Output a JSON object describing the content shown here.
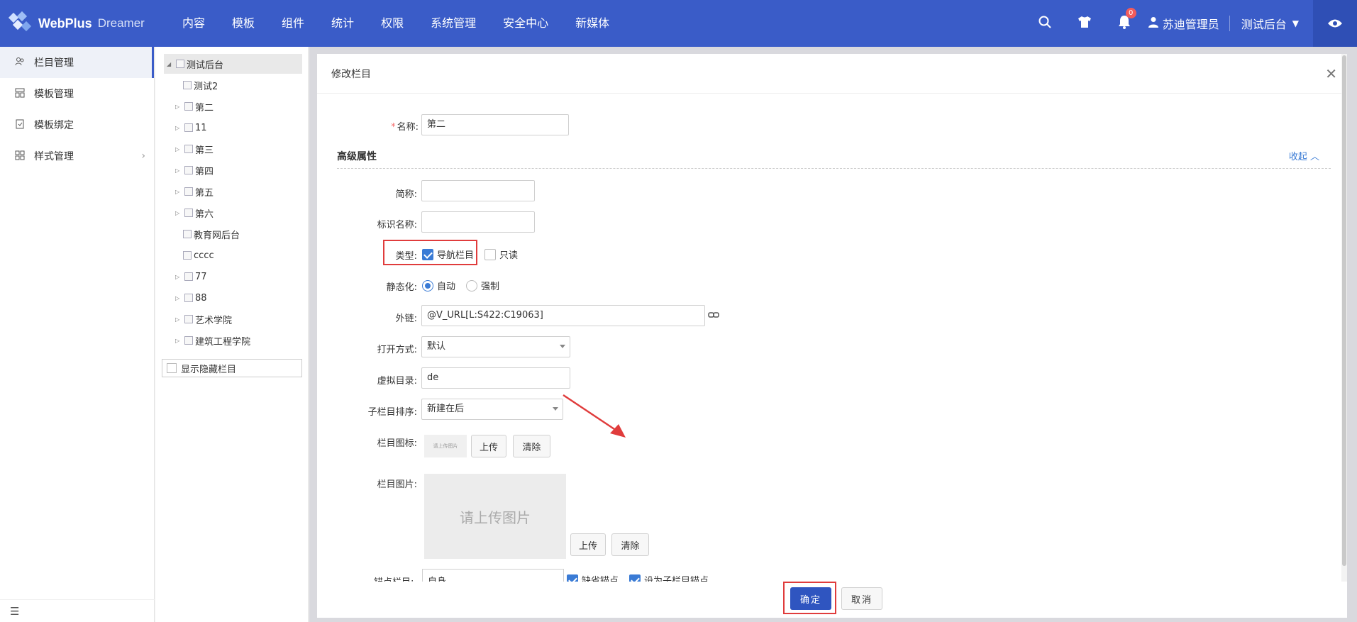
{
  "header": {
    "logo_text": "WebPlus",
    "logo_sub": "Dreamer",
    "nav": [
      "内容",
      "模板",
      "组件",
      "统计",
      "权限",
      "系统管理",
      "安全中心",
      "新媒体"
    ],
    "notification_count": "0",
    "user_name": "苏迪管理员",
    "site_name": "测试后台",
    "brand_color": "#3a5cc8"
  },
  "sidebar": {
    "items": [
      {
        "label": "栏目管理",
        "icon": "users-icon"
      },
      {
        "label": "模板管理",
        "icon": "template-icon"
      },
      {
        "label": "模板绑定",
        "icon": "bind-icon"
      },
      {
        "label": "样式管理",
        "icon": "style-icon"
      }
    ]
  },
  "tree": {
    "root": "测试后台",
    "items": [
      "测试2",
      "第二",
      "11",
      "第三",
      "第四",
      "第五",
      "第六",
      "教育网后台",
      "cccc",
      "77",
      "88",
      "艺术学院",
      "建筑工程学院"
    ],
    "show_hidden_label": "显示隐藏栏目"
  },
  "dialog": {
    "title": "修改栏目",
    "name_label": "名称:",
    "name_value": "第二",
    "section_title": "高级属性",
    "collapse_label": "收起",
    "short_name_label": "简称:",
    "short_name_value": "",
    "ident_label": "标识名称:",
    "ident_value": "",
    "type_label": "类型:",
    "type_nav_label": "导航栏目",
    "type_readonly_label": "只读",
    "static_label": "静态化:",
    "static_auto": "自动",
    "static_force": "强制",
    "link_label": "外链:",
    "link_value": "@V_URL[L:S422:C19063]",
    "open_label": "打开方式:",
    "open_value": "默认",
    "vdir_label": "虚拟目录:",
    "vdir_value": "de",
    "sort_label": "子栏目排序:",
    "sort_value": "新建在后",
    "icon_label": "栏目图标:",
    "icon_thumb_text": "请上传图片",
    "upload": "上传",
    "clear": "清除",
    "image_label": "栏目图片:",
    "image_placeholder": "请上传图片",
    "anchor_label": "锚点栏目:",
    "anchor_value": "自身",
    "anchor_default": "缺省锚点",
    "anchor_child": "设为子栏目锚点",
    "ok": "确定",
    "cancel": "取消"
  }
}
